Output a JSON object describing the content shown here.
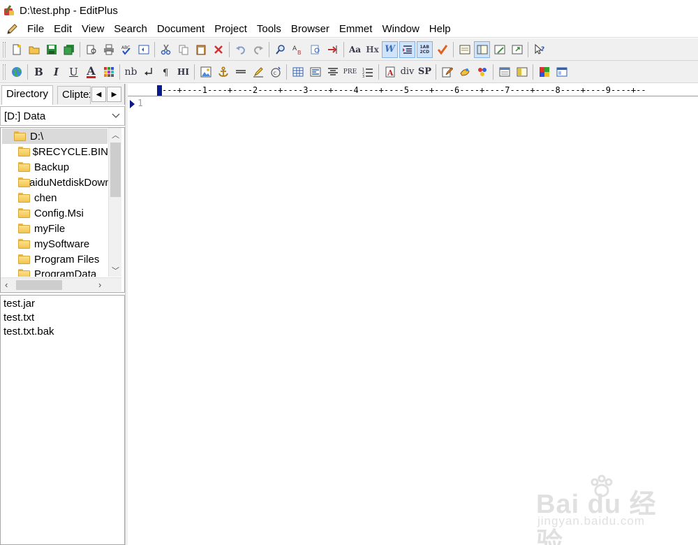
{
  "window": {
    "title": "D:\\test.php - EditPlus"
  },
  "menu": [
    "File",
    "Edit",
    "View",
    "Search",
    "Document",
    "Project",
    "Tools",
    "Browser",
    "Emmet",
    "Window",
    "Help"
  ],
  "toolbar2_text": {
    "bold": "B",
    "italic": "I",
    "underline": "U",
    "font_color": "A",
    "nbsp": "nb",
    "heading": "HI",
    "pre": "PRE",
    "div": "div",
    "span": "SP"
  },
  "toolbar1_text": {
    "font_style": "Aa",
    "hex": "Hx",
    "word_wrap": "W",
    "line_numbers": "1AB 2CD"
  },
  "panel": {
    "tabs": [
      "Directory",
      "Cliptext"
    ],
    "drive": "[D:] Data",
    "tree": [
      "D:\\",
      "$RECYCLE.BIN",
      "Backup",
      "BaiduNetdiskDownload",
      "chen",
      "Config.Msi",
      "myFile",
      "mySoftware",
      "Program Files",
      "ProgramData"
    ],
    "files": [
      "test.jar",
      "test.txt",
      "test.txt.bak"
    ]
  },
  "editor": {
    "ruler": "---+----1----+----2----+----3----+----4----+----5----+----6----+----7----+----8----+----9----+--",
    "line_number": "1"
  },
  "watermark": {
    "brand": "Bai du 经验",
    "url": "jingyan.baidu.com"
  },
  "colors": {
    "accent": "#0a1a8a",
    "toolbar_bg": "#f0f0f0",
    "folder": "#f3c44e"
  }
}
